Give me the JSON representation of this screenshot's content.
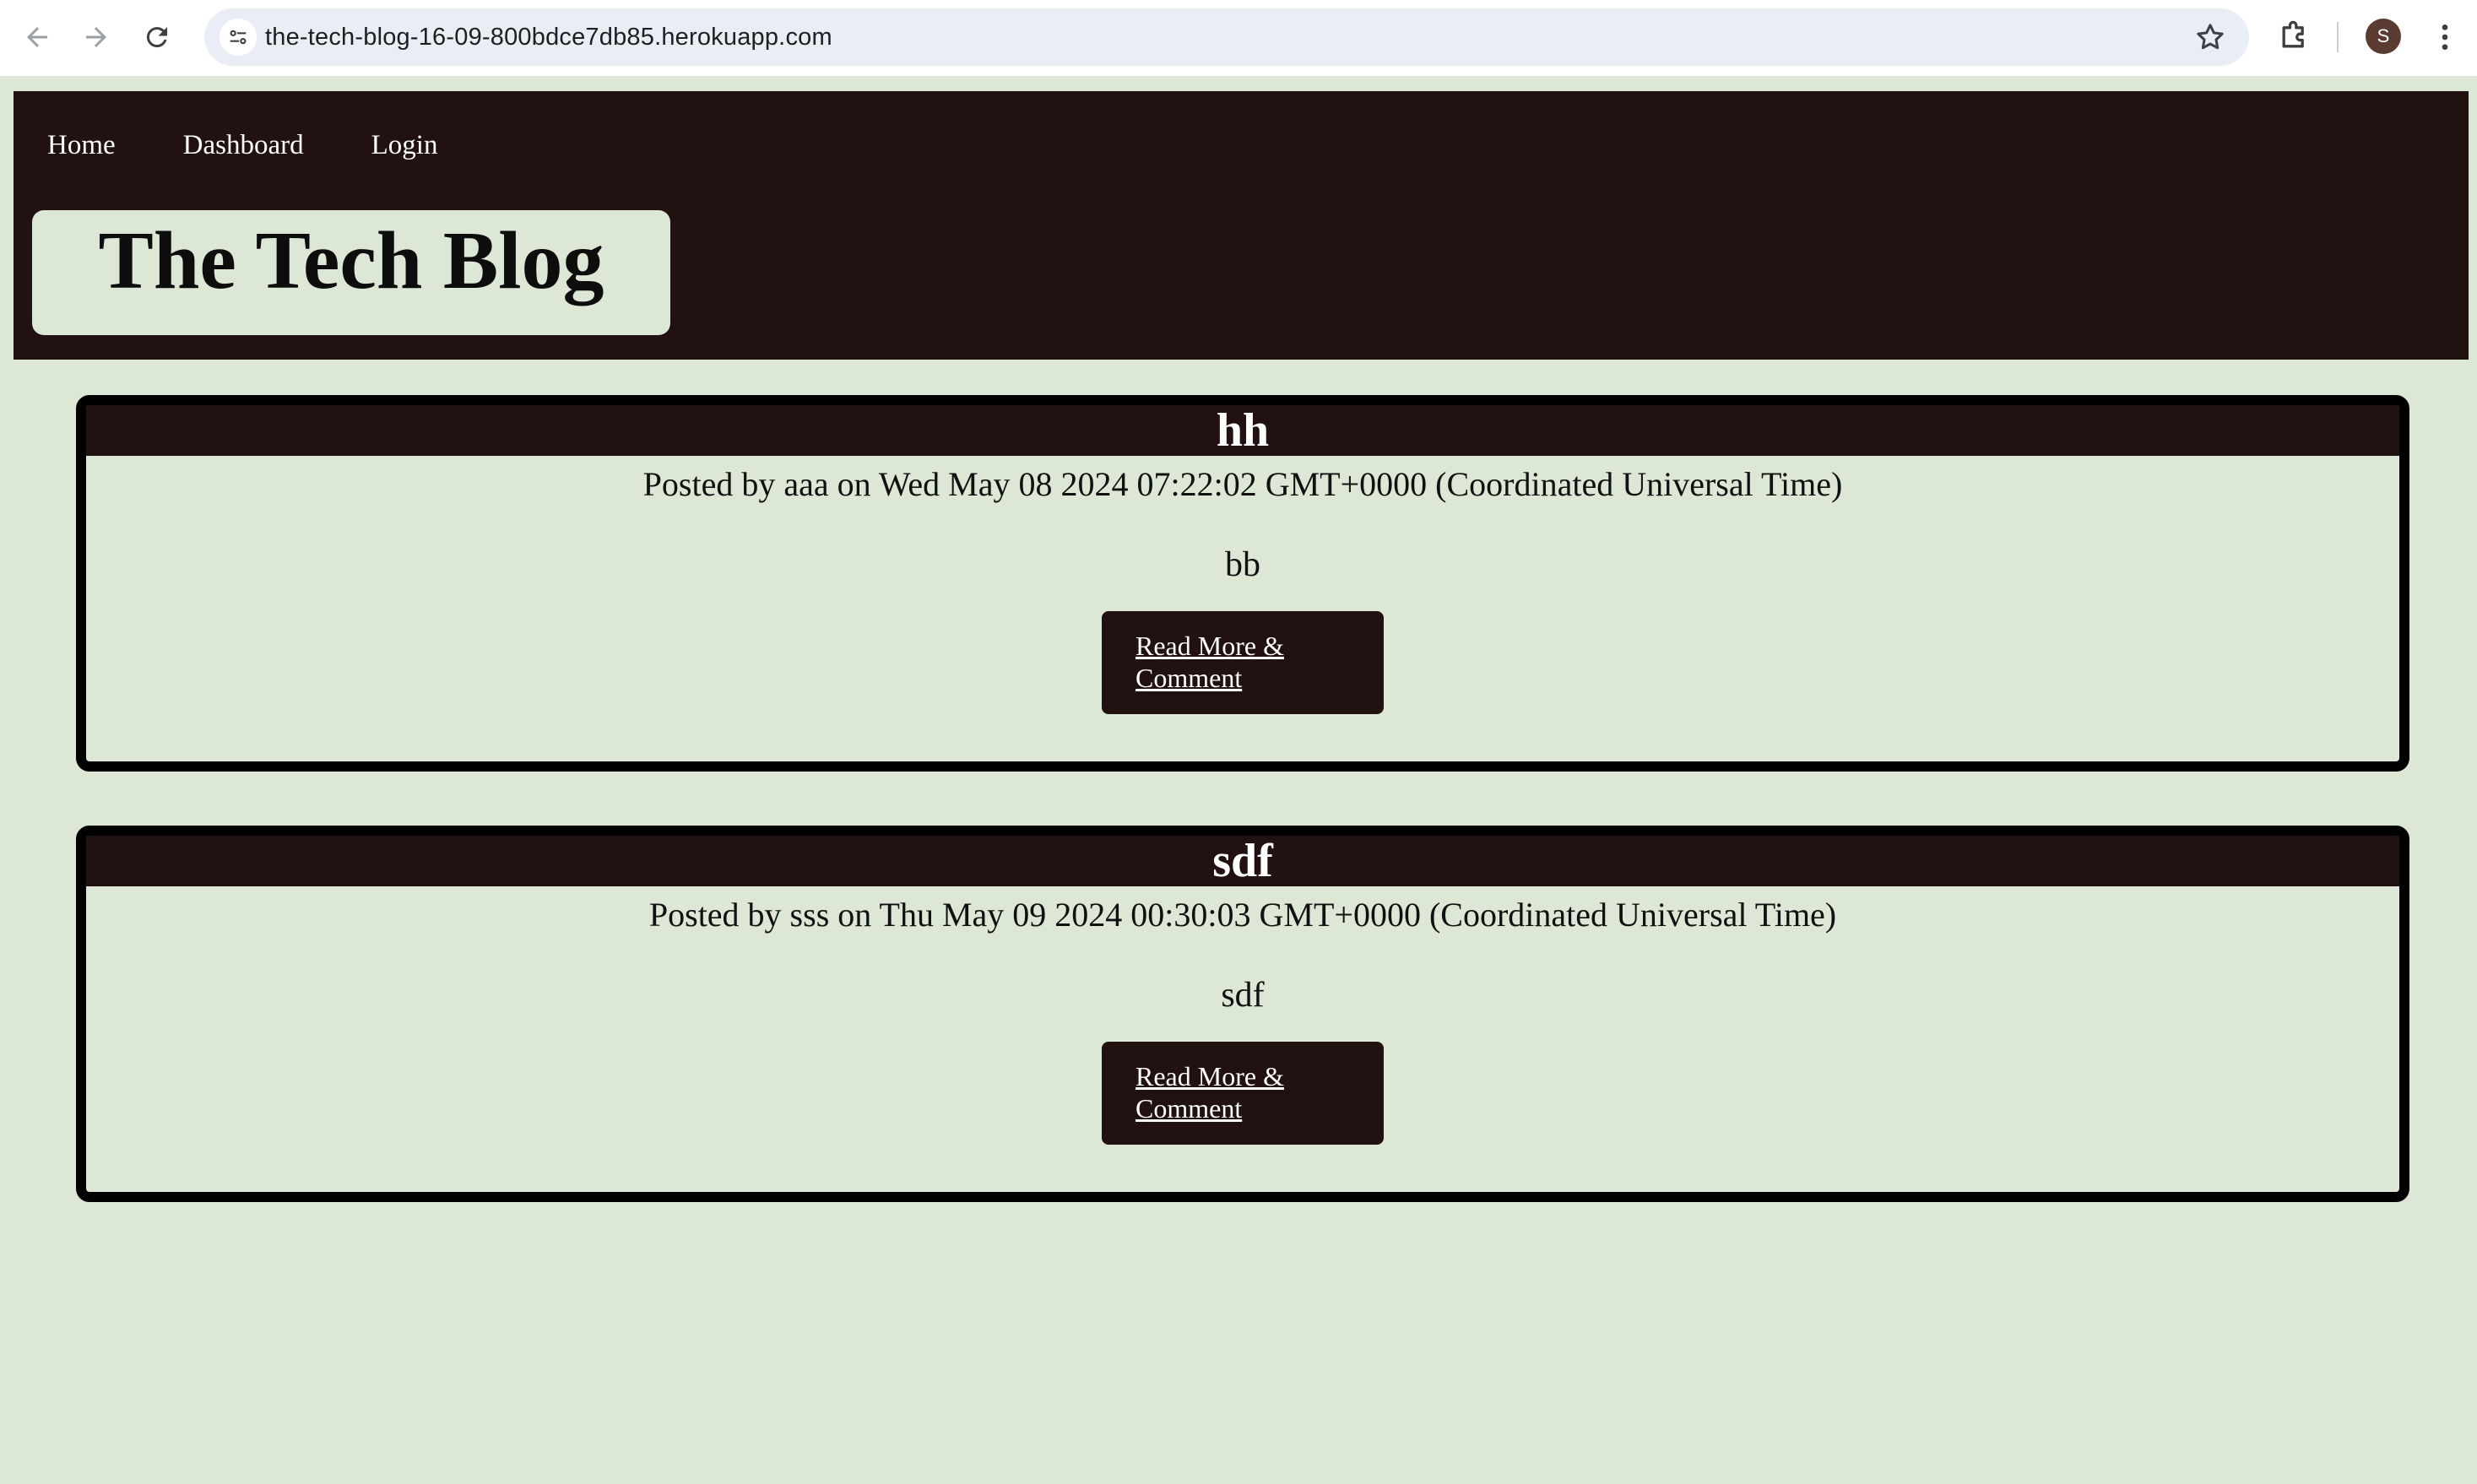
{
  "browser": {
    "url": "the-tech-blog-16-09-800bdce7db85.herokuapp.com",
    "profile_initial": "S",
    "icons": [
      "back-arrow-icon",
      "forward-arrow-icon",
      "reload-icon",
      "site-info-icon",
      "bookmark-star-icon",
      "extensions-puzzle-icon",
      "kebab-menu-icon"
    ]
  },
  "nav": {
    "items": [
      {
        "label": "Home"
      },
      {
        "label": "Dashboard"
      },
      {
        "label": "Login"
      }
    ]
  },
  "site": {
    "title": "The Tech Blog"
  },
  "posts": [
    {
      "title": "hh",
      "meta": "Posted by aaa on Wed May 08 2024 07:22:02 GMT+0000 (Coordinated Universal Time)",
      "body": "bb",
      "button_label": "Read More & Comment"
    },
    {
      "title": "sdf",
      "meta": "Posted by sss on Thu May 09 2024 00:30:03 GMT+0000 (Coordinated Universal Time)",
      "body": "sdf",
      "button_label": "Read More & Comment"
    }
  ],
  "colors": {
    "page_background": "#dce7d5",
    "header_background": "#211111",
    "post_border": "#000000"
  }
}
